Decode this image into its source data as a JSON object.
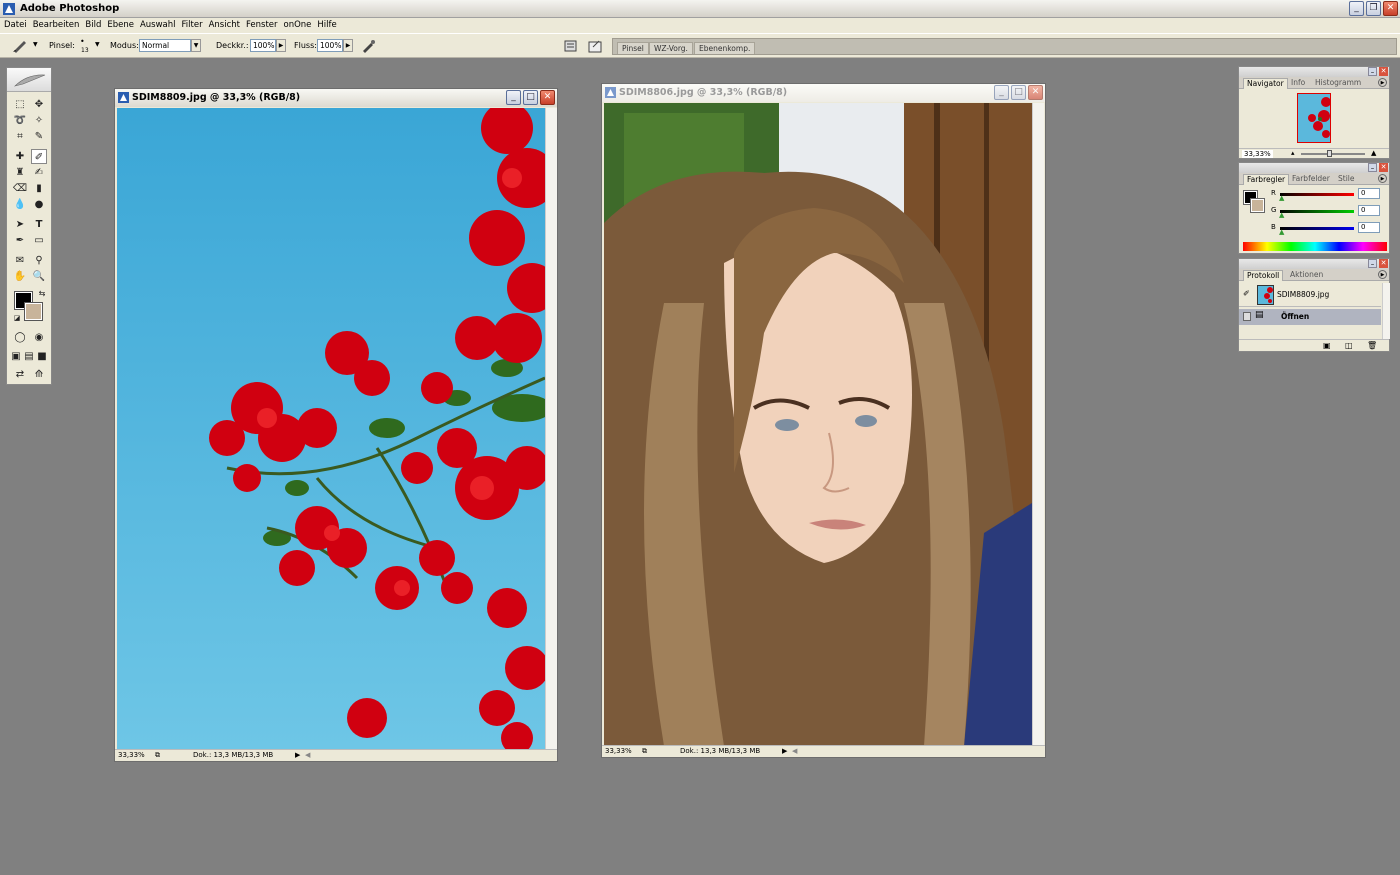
{
  "app": {
    "title": "Adobe Photoshop"
  },
  "menu": [
    "Datei",
    "Bearbeiten",
    "Bild",
    "Ebene",
    "Auswahl",
    "Filter",
    "Ansicht",
    "Fenster",
    "onOne",
    "Hilfe"
  ],
  "options": {
    "pinsel_label": "Pinsel:",
    "brush_size": "13",
    "modus_label": "Modus:",
    "modus_value": "Normal",
    "deckkr_label": "Deckkr.:",
    "deckkr_value": "100%",
    "fluss_label": "Fluss:",
    "fluss_value": "100%"
  },
  "dock_tabs": [
    "Pinsel",
    "WZ-Vorg.",
    "Ebenenkomp."
  ],
  "documents": [
    {
      "title": "SDIM8809.jpg @ 33,3% (RGB/8)",
      "zoom": "33,33%",
      "doc_info": "Dok.: 13,3 MB/13,3 MB",
      "active": true
    },
    {
      "title": "SDIM8806.jpg @ 33,3% (RGB/8)",
      "zoom": "33,33%",
      "doc_info": "Dok.: 13,3 MB/13,3 MB",
      "active": false
    }
  ],
  "navigator": {
    "tabs": [
      "Navigator",
      "Info",
      "Histogramm"
    ],
    "zoom": "33,33%"
  },
  "color": {
    "tabs": [
      "Farbregler",
      "Farbfelder",
      "Stile"
    ],
    "channels": [
      {
        "label": "R",
        "value": "0",
        "color": "#e02020"
      },
      {
        "label": "G",
        "value": "0",
        "color": "#20b020"
      },
      {
        "label": "B",
        "value": "0",
        "color": "#2030d0"
      }
    ]
  },
  "history": {
    "tabs": [
      "Protokoll",
      "Aktionen"
    ],
    "snapshot": "SDIM8809.jpg",
    "step": "Öffnen"
  },
  "colors": {
    "foreground": "#000000",
    "background": "#c8b49a",
    "workspace": "#808080"
  }
}
